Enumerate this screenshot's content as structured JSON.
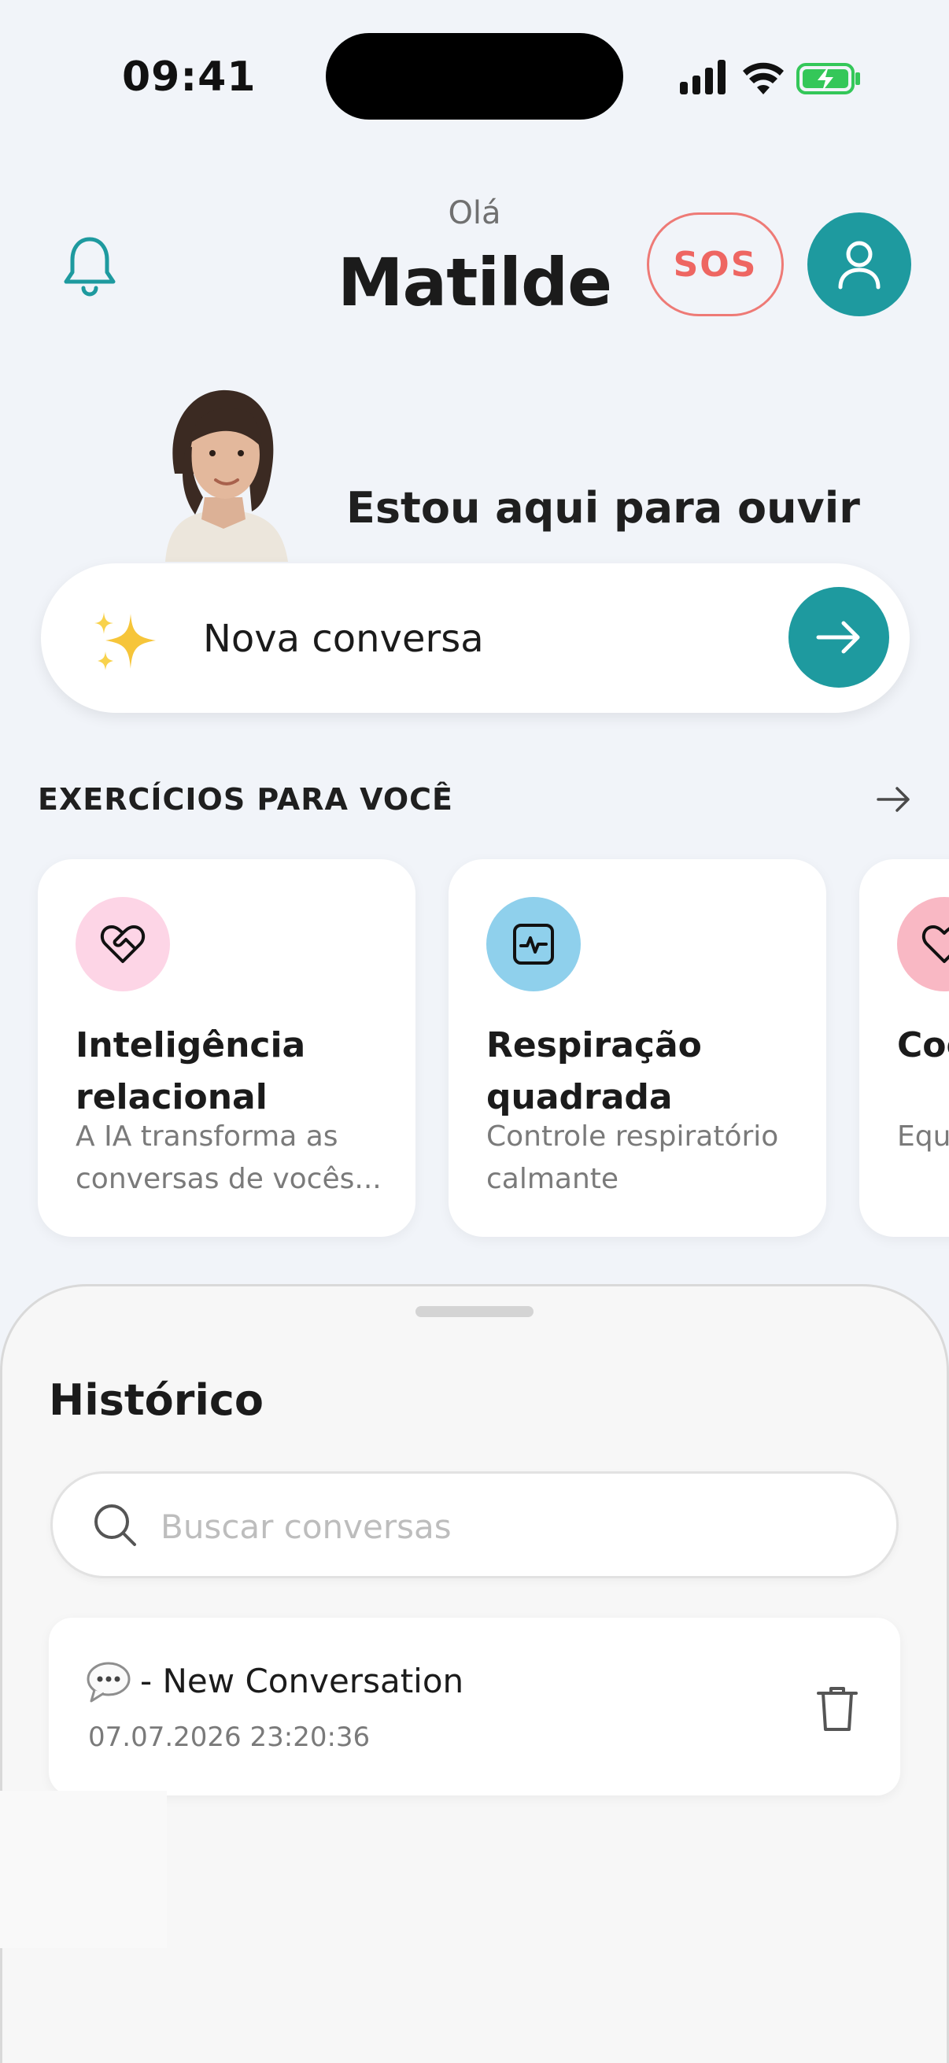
{
  "status_bar": {
    "time": "09:41"
  },
  "header": {
    "greeting": "Olá",
    "user_name": "Matilde",
    "sos_label": "SOS"
  },
  "hero": {
    "message": "Estou aqui para ouvir"
  },
  "chat_entry": {
    "label": "Nova conversa"
  },
  "exercises": {
    "title": "EXERCÍCIOS PARA VOCÊ",
    "cards": [
      {
        "title": "Inteligência relacional",
        "subtitle": "A IA transforma as conversas de vocês...",
        "icon": "heart-handshake-icon",
        "icon_bg": "#fdd5e6"
      },
      {
        "title": "Respiração quadrada",
        "subtitle": "Controle respiratório calmante",
        "icon": "pulse-square-icon",
        "icon_bg": "#8fd0ec"
      },
      {
        "title": "Coc car",
        "subtitle": "Equ car",
        "icon": "heart-pulse-icon",
        "icon_bg": "#f9b8c4"
      }
    ]
  },
  "history": {
    "title": "Histórico",
    "search_placeholder": "Buscar conversas",
    "items": [
      {
        "title": "- New Conversation",
        "date": "07.07.2026 23:20:36",
        "icon": "speech-bubble-icon"
      }
    ]
  },
  "colors": {
    "accent": "#1e9a9f",
    "sos": "#ee6662",
    "background": "#f1f4f9"
  }
}
